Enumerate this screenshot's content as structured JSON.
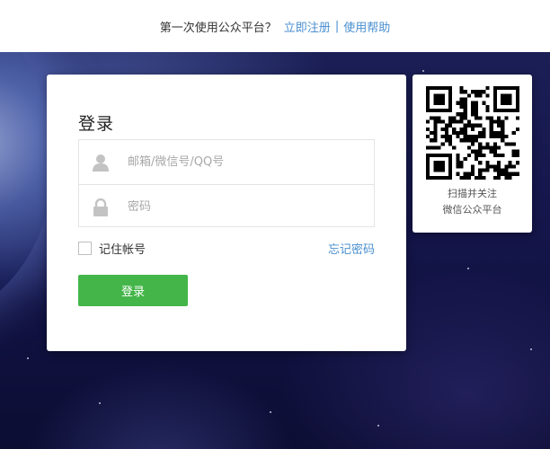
{
  "header": {
    "prompt": "第一次使用公众平台？",
    "register_link": "立即注册",
    "separator": "|",
    "help_link": "使用帮助"
  },
  "login": {
    "title": "登录",
    "account_placeholder": "邮箱/微信号/QQ号",
    "password_placeholder": "密码",
    "remember_label": "记住帐号",
    "forgot_link": "忘记密码",
    "submit_label": "登录"
  },
  "qr": {
    "caption_line1": "扫描并关注",
    "caption_line2": "微信公众平台"
  },
  "colors": {
    "accent_link": "#4a8fd0",
    "button_green": "#44b549"
  },
  "icons": {
    "account": "user-icon",
    "password": "lock-icon",
    "qr": "qr-code-icon"
  }
}
